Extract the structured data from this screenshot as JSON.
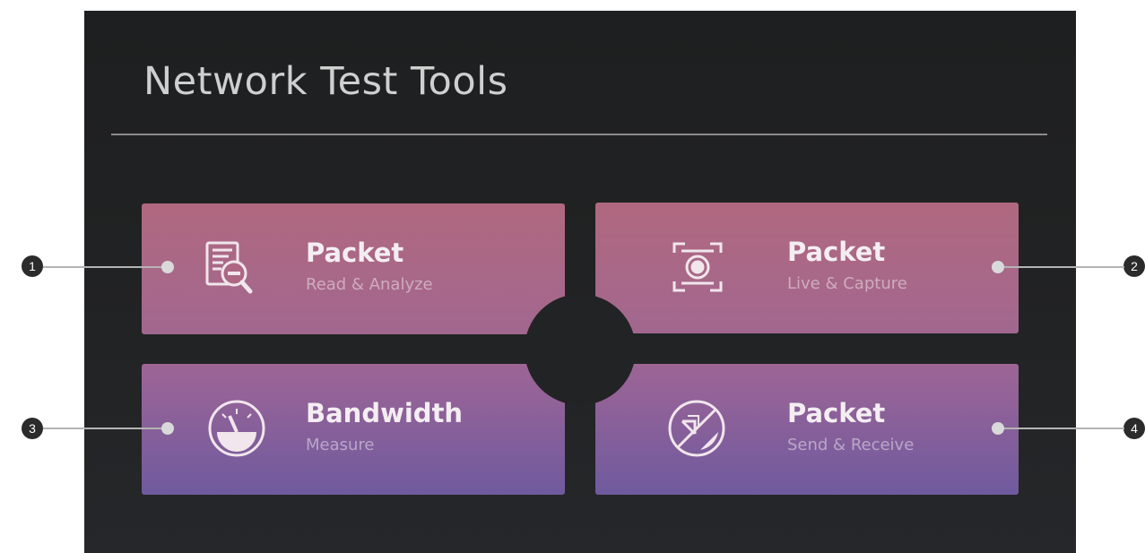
{
  "page": {
    "title": "Network Test Tools"
  },
  "tiles": [
    {
      "heading": "Packet",
      "subtitle": "Read & Analyze",
      "icon": "document-magnifier-icon",
      "callout": "1"
    },
    {
      "heading": "Packet",
      "subtitle": "Live & Capture",
      "icon": "capture-frame-icon",
      "callout": "2"
    },
    {
      "heading": "Bandwidth",
      "subtitle": "Measure",
      "icon": "gauge-icon",
      "callout": "3"
    },
    {
      "heading": "Packet",
      "subtitle": "Send & Receive",
      "icon": "send-receive-arrows-icon",
      "callout": "4"
    }
  ],
  "colors": {
    "background": "#1f2021",
    "tile_top": "#b0687f",
    "tile_bottom": "#6f5a9e",
    "callout_line": "#b4b4b4",
    "badge": "#2b2b2b"
  }
}
